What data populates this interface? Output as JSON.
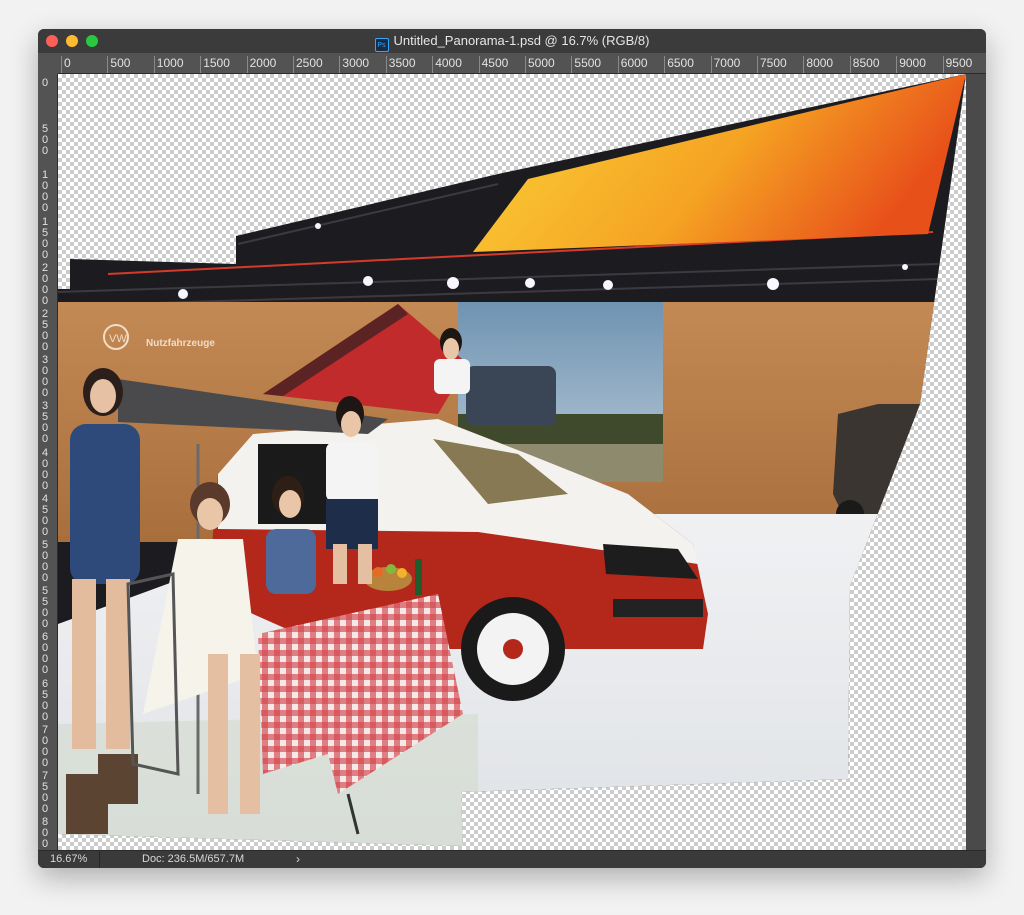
{
  "window": {
    "title": "Untitled_Panorama-1.psd @ 16.7% (RGB/8)",
    "app_icon_label": "Ps",
    "traffic_lights": {
      "close": "#fe5f57",
      "minimize": "#febc2e",
      "maximize": "#28c840"
    }
  },
  "rulers": {
    "horizontal": [
      "0",
      "500",
      "1000",
      "1500",
      "2000",
      "2500",
      "3000",
      "3500",
      "4000",
      "4500",
      "5000",
      "5500",
      "6000",
      "6500",
      "7000",
      "7500",
      "8000",
      "8500",
      "9000",
      "9500"
    ],
    "vertical": [
      "0",
      "500",
      "1000",
      "1500",
      "2000",
      "2500",
      "3000",
      "3500",
      "4000",
      "4500",
      "5000",
      "5500",
      "6000",
      "6500",
      "7000",
      "7500",
      "8000"
    ]
  },
  "canvas": {
    "signage_text": "Nutzfahrzeuge",
    "transparency_pattern": "checkerboard"
  },
  "status": {
    "zoom": "16.67%",
    "doc_info": "Doc: 236.5M/657.7M",
    "arrow": "›"
  },
  "colors": {
    "van_red": "#b3281a",
    "van_white": "#f4f2ee",
    "ceiling_orange": "#f39a1e",
    "backdrop_wood": "#c78a52"
  }
}
